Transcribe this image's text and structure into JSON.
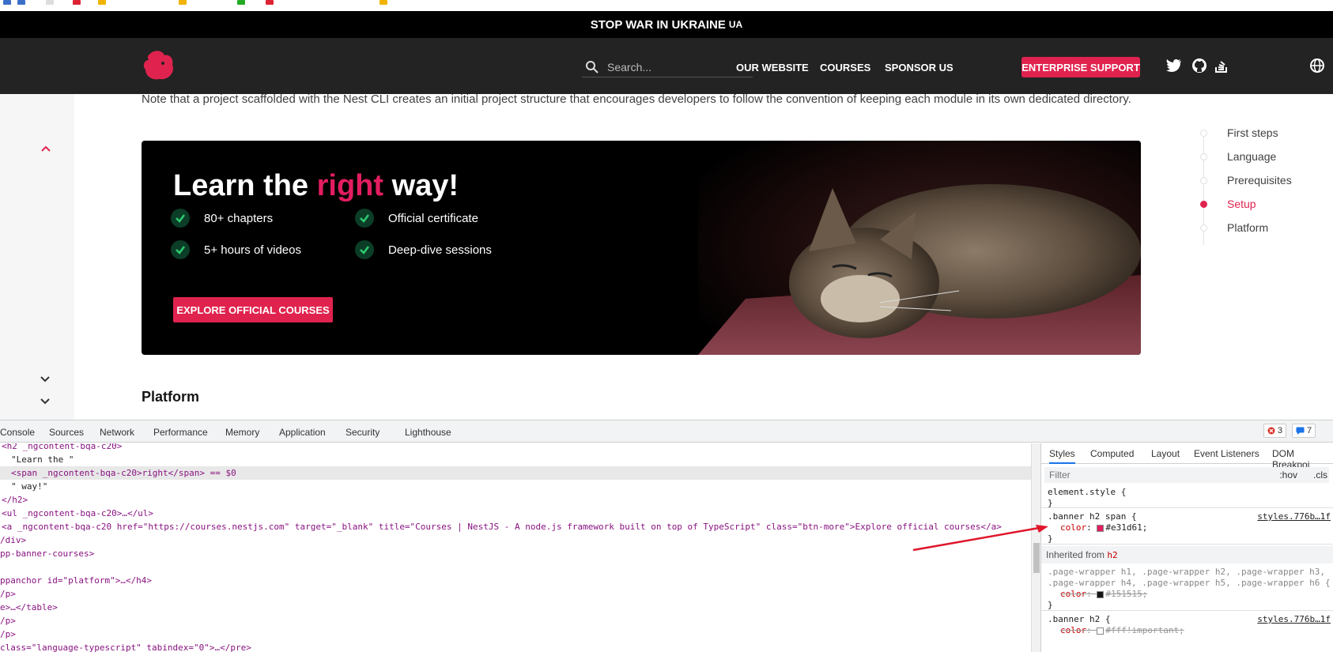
{
  "banner_top": {
    "text": "STOP WAR IN UKRAINE",
    "flag": "UA"
  },
  "nav": {
    "search_placeholder": "Search...",
    "links": [
      "OUR WEBSITE",
      "COURSES",
      "SPONSOR US"
    ],
    "enterprise": "ENTERPRISE SUPPORT",
    "social_icons": [
      "twitter-icon",
      "github-icon",
      "stackoverflow-icon",
      "globe-icon"
    ]
  },
  "content": {
    "note": "Note that a project scaffolded with the Nest CLI creates an initial project structure that encourages developers to follow the convention of keeping each module in its own dedicated directory.",
    "course_banner": {
      "title_pre": "Learn the ",
      "title_highlight": "right",
      "title_post": " way!",
      "features": [
        "80+ chapters",
        "Official certificate",
        "5+ hours of videos",
        "Deep-dive sessions"
      ],
      "button": "EXPLORE OFFICIAL COURSES"
    },
    "next_heading": "Platform"
  },
  "toc": {
    "items": [
      "First steps",
      "Language",
      "Prerequisites",
      "Setup",
      "Platform"
    ],
    "active_index": 3
  },
  "devtools": {
    "tabs": [
      "Console",
      "Sources",
      "Network",
      "Performance",
      "Memory",
      "Application",
      "Security",
      "Lighthouse"
    ],
    "errors": "3",
    "messages": "7",
    "elements": [
      "<h2 _ngcontent-bqa-c20>",
      "\"Learn the \"",
      "<span _ngcontent-bqa-c20>right</span> == $0",
      "\" way!\"",
      "</h2>",
      "<ul _ngcontent-bqa-c20>…</ul>",
      "<a _ngcontent-bqa-c20 href=\"https://courses.nestjs.com\" target=\"_blank\" title=\"Courses | NestJS - A node.js framework built on top of TypeScript\" class=\"btn-more\">Explore official courses</a>",
      "/div>",
      "pp-banner-courses>",
      "",
      "ppanchor id=\"platform\">…</h4>",
      "/p>",
      "e>…</table>",
      "/p>",
      "/p>",
      "class=\"language-typescript\" tabindex=\"0\">…</pre>"
    ],
    "styles": {
      "tabs": [
        "Styles",
        "Computed",
        "Layout",
        "Event Listeners",
        "DOM Breakpoi"
      ],
      "filter_placeholder": "Filter",
      "hov": ":hov",
      "cls": ".cls",
      "element_style": "element.style {",
      "rule1_selector": ".banner h2 span {",
      "rule1_source": "styles.776b…1f",
      "rule1_prop": "color",
      "rule1_value": "#e31d61;",
      "rule1_color": "#e31d61",
      "inherited_label": "Inherited from",
      "inherited_from": "h2",
      "rule2_selector_a": ".page-wrapper h1, .page-wrapper h2, .page-wrapper h3,",
      "rule2_selector_b": ".page-wrapper h4, .page-wrapper h5, .page-wrapper h6 {",
      "rule2_prop": "color",
      "rule2_value": "#151515;",
      "rule2_color": "#151515",
      "rule3_selector": ".banner h2 {",
      "rule3_source": "styles.776b…1f",
      "rule3_prop": "color",
      "rule3_value": "#fff!important;",
      "rule3_color": "#ffffff"
    }
  },
  "colors": {
    "brand": "#e0234e",
    "highlight": "#e31d61",
    "nav_bg": "#232323",
    "arrow": "#e0162b"
  }
}
